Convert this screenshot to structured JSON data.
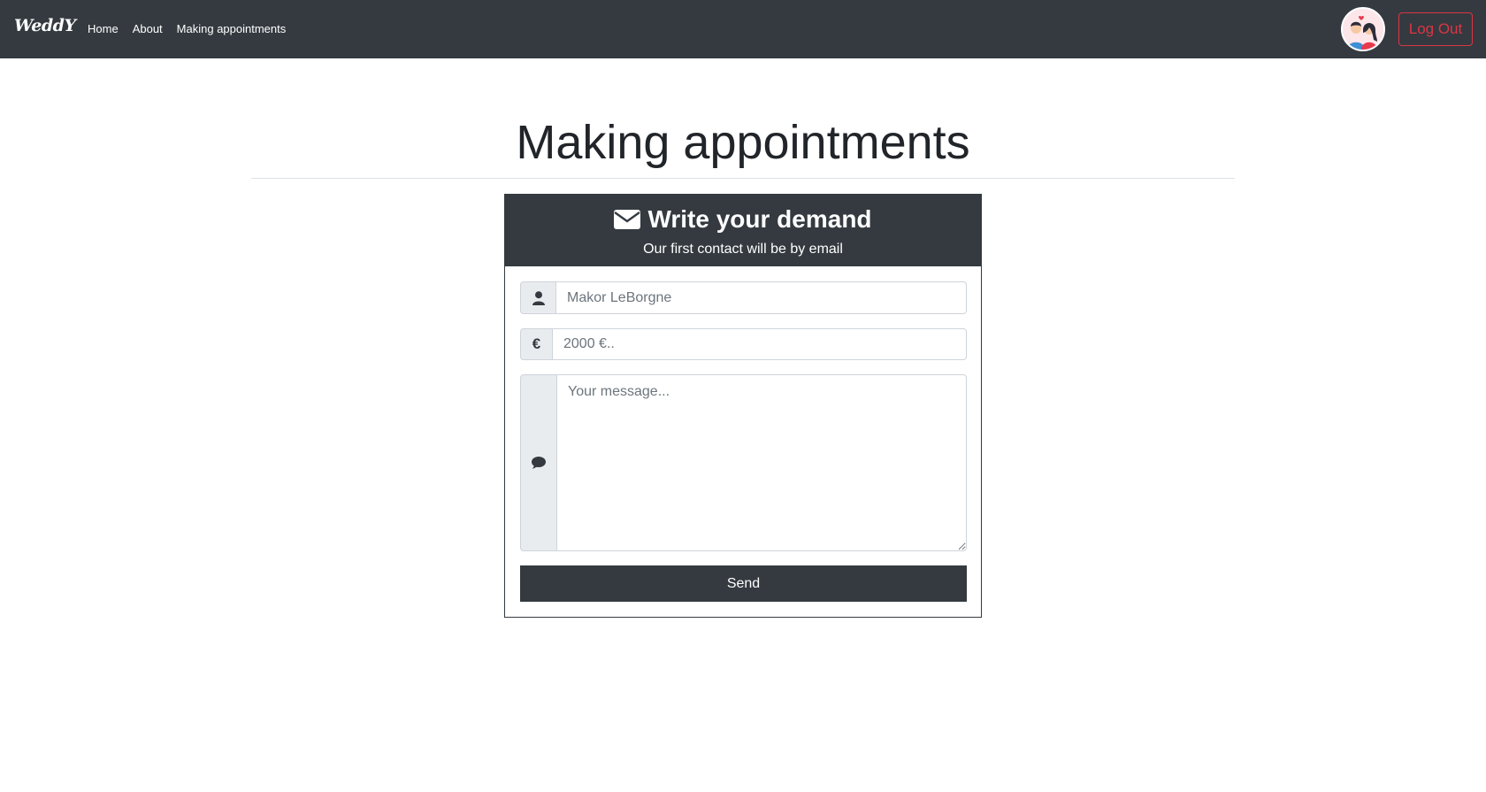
{
  "navbar": {
    "brand": "WeddY",
    "links": [
      "Home",
      "About",
      "Making appointments"
    ],
    "logout_label": "Log Out"
  },
  "page": {
    "title": "Making appointments"
  },
  "form": {
    "heading": "Write your demand",
    "subheading": "Our first contact will be by email",
    "name_placeholder": "Makor LeBorgne",
    "budget_placeholder": "2000 €..",
    "budget_icon": "€",
    "message_placeholder": "Your message...",
    "send_label": "Send"
  },
  "colors": {
    "navbar_bg": "#343a40",
    "danger": "#dc3545",
    "addon_bg": "#e9ecef"
  },
  "icons": [
    "envelope-icon",
    "user-icon",
    "euro-icon",
    "comment-icon"
  ]
}
